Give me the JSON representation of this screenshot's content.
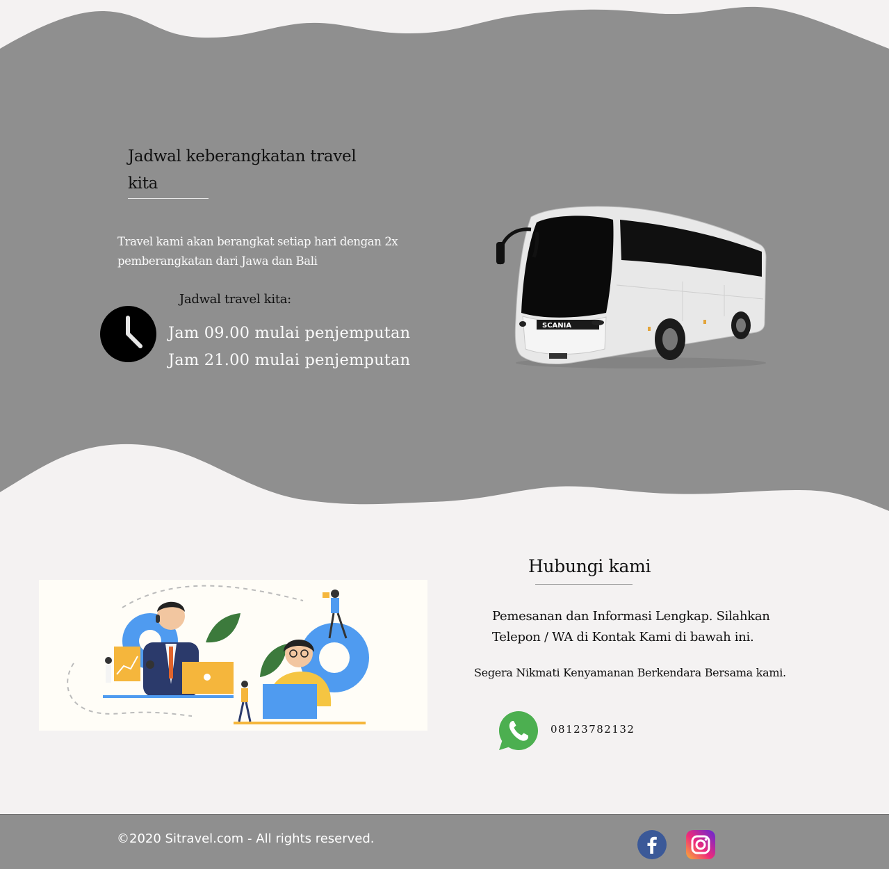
{
  "schedule": {
    "title_line1": "Jadwal keberangkatan travel",
    "title_line2": "kita",
    "description_line1": "Travel kami akan berangkat setiap hari dengan 2x",
    "description_line2": "pemberangkatan dari Jawa dan Bali",
    "times_label": "Jadwal travel kita:",
    "times": [
      "Jam 09.00 mulai penjemputan",
      "Jam 21.00 mulai penjemputan"
    ],
    "icon": "clock-icon"
  },
  "hero_image": {
    "bus_brand": "SCANIA"
  },
  "contact": {
    "title": "Hubungi kami",
    "description_line1": "Pemesanan dan Informasi Lengkap. Silahkan",
    "description_line2": "Telepon / WA di Kontak Kami di bawah ini.",
    "note": "Segera Nikmati Kenyamanan Berkendara Bersama kami.",
    "phone": "08123782132",
    "phone_icon": "whatsapp-icon"
  },
  "footer": {
    "copyright": "©2020 Sitravel.com - All rights reserved.",
    "social": [
      "facebook-icon",
      "instagram-icon"
    ]
  },
  "colors": {
    "band": "#8f8f8f",
    "background": "#f4f2f2",
    "whatsapp": "#4caf50",
    "facebook": "#3b5998"
  }
}
